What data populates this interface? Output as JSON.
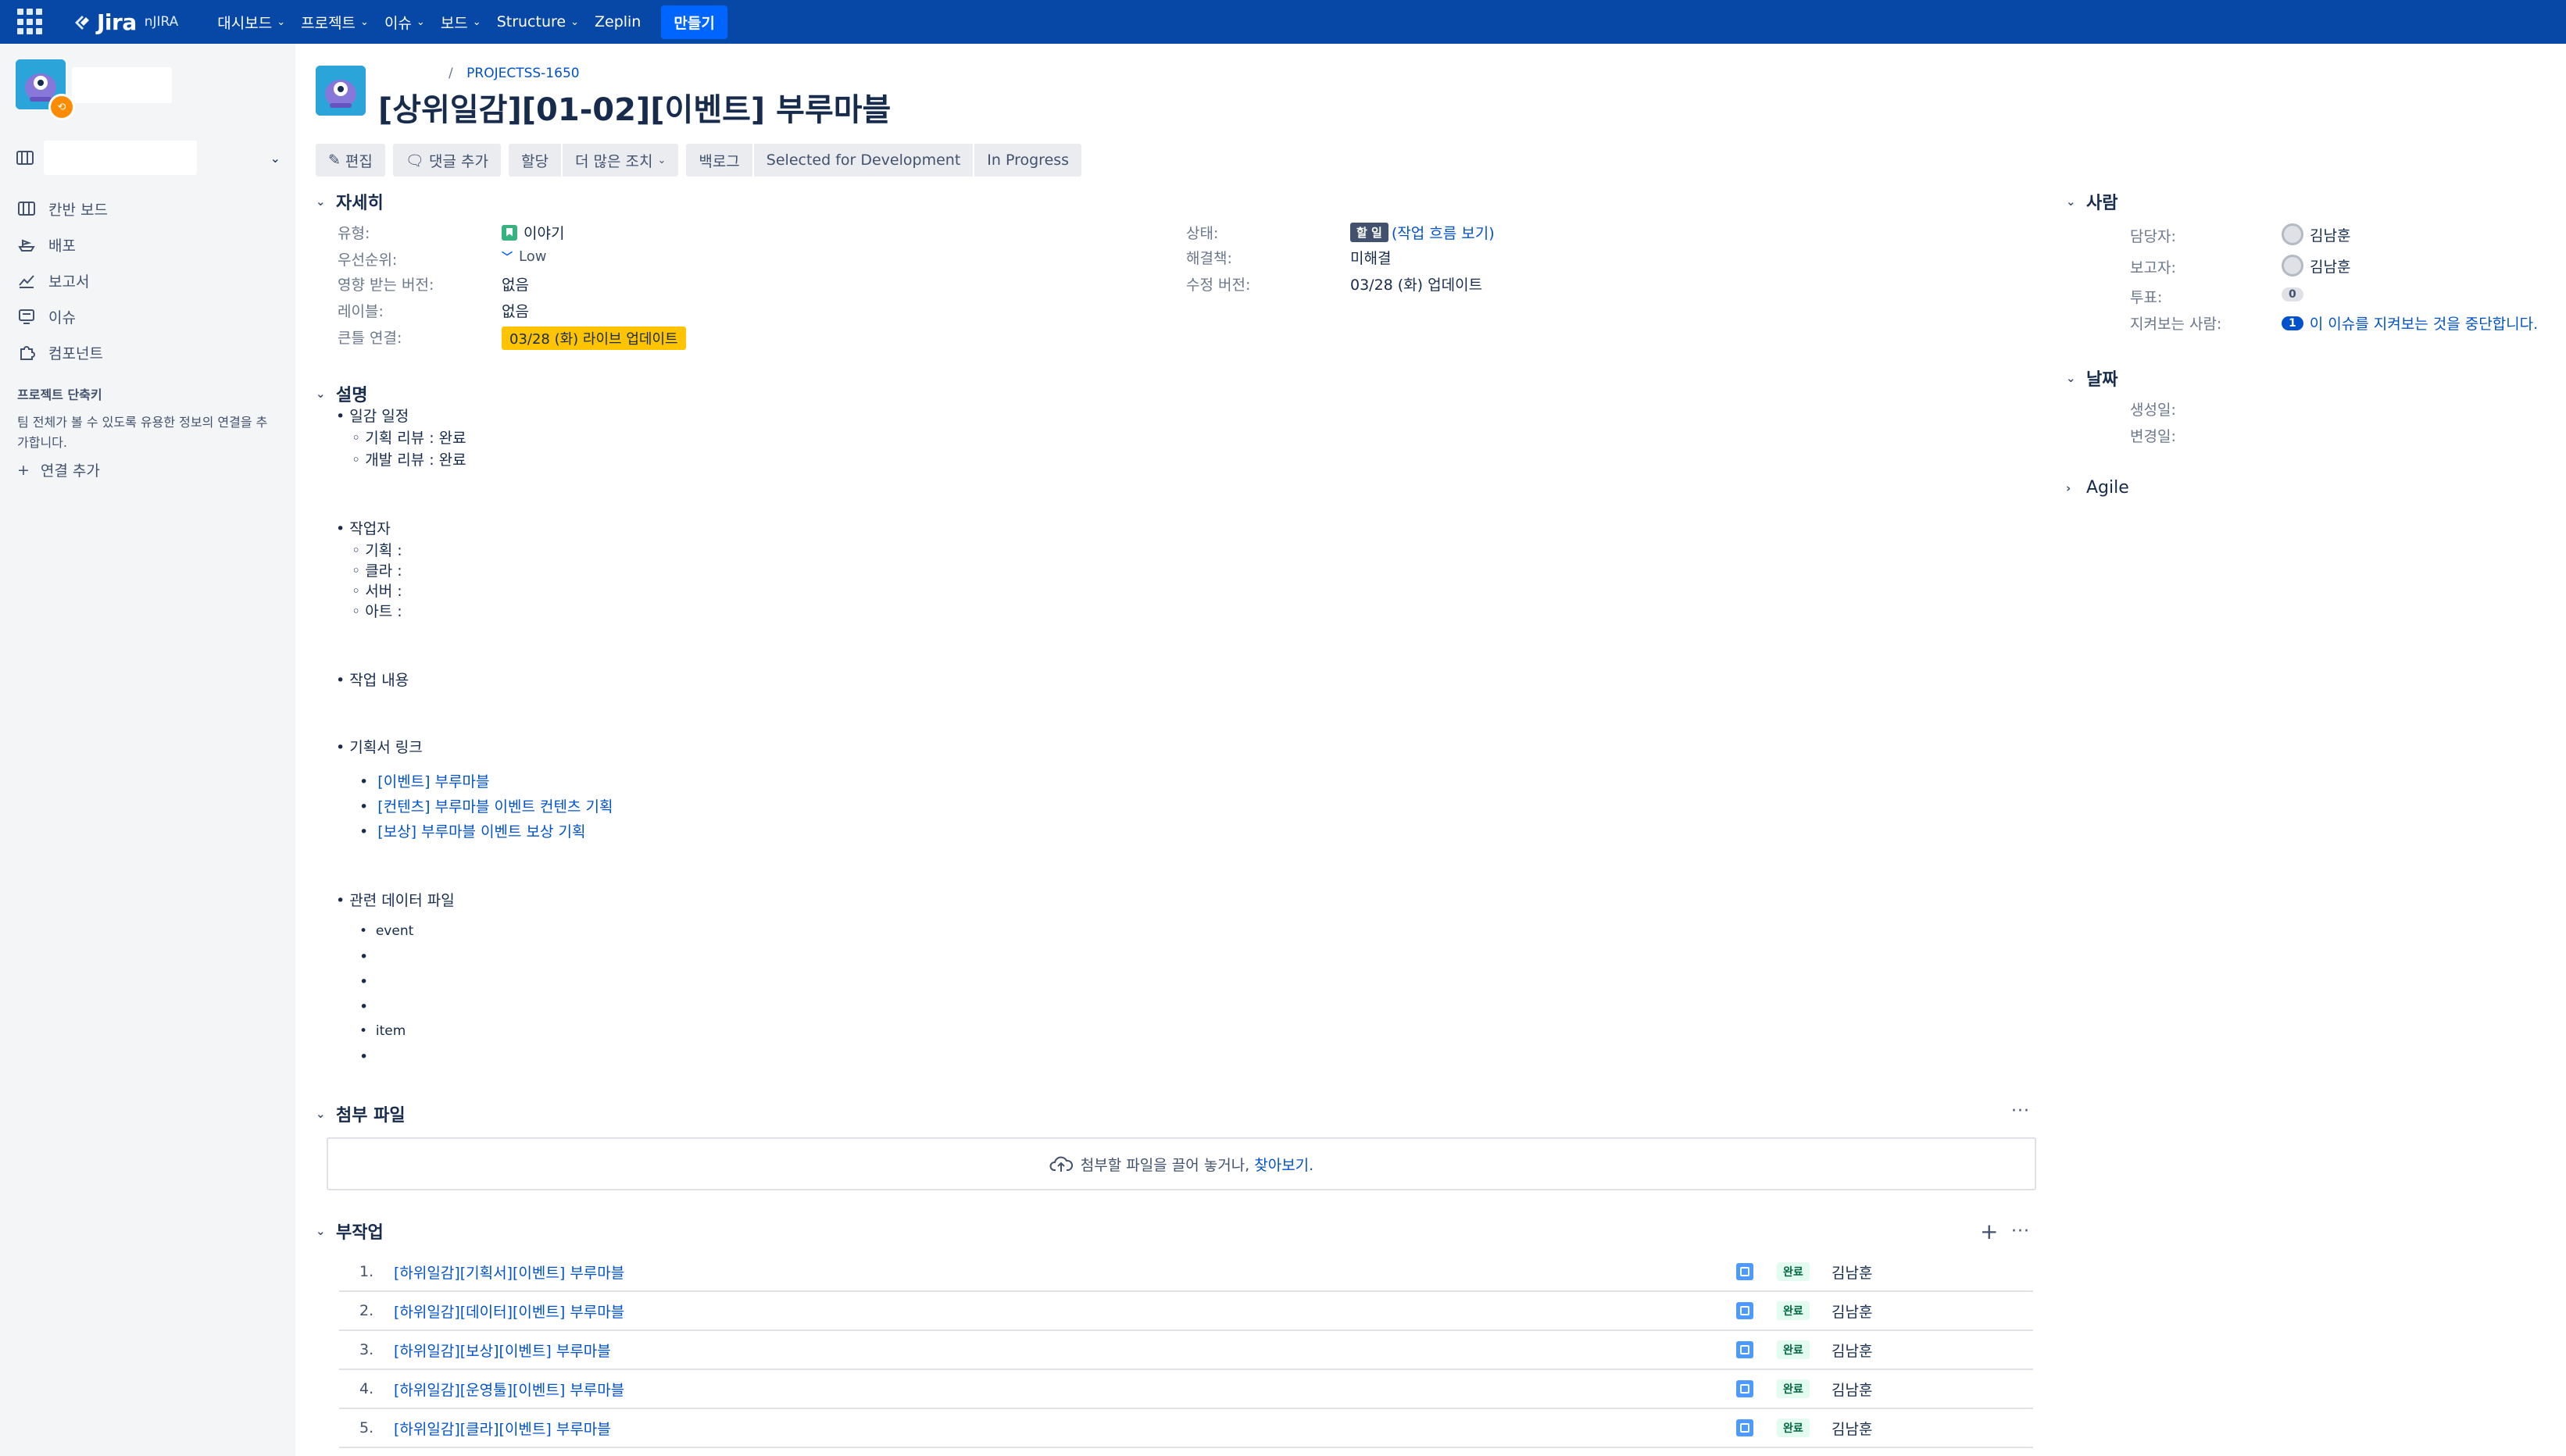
{
  "topnav": {
    "logo_text": "Jira",
    "logo_sub": "nJIRA",
    "menu": [
      {
        "label": "대시보드",
        "has_dropdown": true
      },
      {
        "label": "프로젝트",
        "has_dropdown": true
      },
      {
        "label": "이슈",
        "has_dropdown": true
      },
      {
        "label": "보드",
        "has_dropdown": true
      },
      {
        "label": "Structure",
        "has_dropdown": true
      },
      {
        "label": "Zeplin",
        "has_dropdown": false
      }
    ],
    "create_label": "만들기"
  },
  "sidebar": {
    "nav": [
      {
        "label": "칸반 보드",
        "icon": "board-icon"
      },
      {
        "label": "배포",
        "icon": "ship-icon"
      },
      {
        "label": "보고서",
        "icon": "chart-icon"
      },
      {
        "label": "이슈",
        "icon": "issues-icon"
      },
      {
        "label": "컴포넌트",
        "icon": "puzzle-icon"
      }
    ],
    "shortcuts_heading": "프로젝트 단축키",
    "shortcuts_desc": "팀 전체가 볼 수 있도록 유용한 정보의 연결을 추가합니다.",
    "add_link_label": "연결 추가"
  },
  "issue": {
    "breadcrumb_sep": "/",
    "key": "PROJECTSS-1650",
    "title": "[상위일감][01-02][이벤트] 부루마블"
  },
  "toolbar": {
    "edit": "편집",
    "comment": "댓글 추가",
    "assign": "할당",
    "more": "더 많은 조치",
    "backlog": "백로그",
    "selected": "Selected for Development",
    "in_progress": "In Progress"
  },
  "details": {
    "heading": "자세히",
    "left": [
      {
        "label": "유형:",
        "value": "이야기"
      },
      {
        "label": "우선순위:",
        "value": "Low"
      },
      {
        "label": "영향 받는 버전:",
        "value": "없음"
      },
      {
        "label": "레이블:",
        "value": "없음"
      },
      {
        "label": "큰틀 연결:",
        "value": "03/28 (화) 라이브 업데이트"
      }
    ],
    "right": [
      {
        "label": "상태:",
        "value": "할 일",
        "extra": "(작업 흐름 보기)"
      },
      {
        "label": "해결책:",
        "value": "미해결"
      },
      {
        "label": "수정 버전:",
        "value": "03/28 (화) 업데이트"
      }
    ]
  },
  "description": {
    "heading": "설명",
    "sched_title": "• 일감 일정",
    "sched_items": [
      "◦ 기획 리뷰 : 완료",
      "◦ 개발 리뷰 : 완료"
    ],
    "workers_title": "• 작업자",
    "workers_items": [
      "◦ 기획 :",
      "◦ 클라 :",
      "◦ 서버 :",
      "◦ 아트 :"
    ],
    "content_title": "• 작업 내용",
    "links_title": "• 기획서 링크",
    "links": [
      "[이벤트] 부루마블",
      "[컨텐츠] 부루마블 이벤트 컨텐츠 기획",
      "[보상] 부루마블 이벤트 보상 기획"
    ],
    "files_title": "• 관련 데이터 파일",
    "files": [
      "event",
      "",
      "",
      "",
      "item",
      ""
    ]
  },
  "attachments": {
    "heading": "첨부 파일",
    "drop_text": "첨부할 파일을 끌어 놓거나,",
    "browse": "찾아보기."
  },
  "subtasks": {
    "heading": "부작업",
    "rows": [
      {
        "num": "1.",
        "title": "[하위일감][기획서][이벤트] 부루마블",
        "status": "완료",
        "assignee": "김남훈"
      },
      {
        "num": "2.",
        "title": "[하위일감][데이터][이벤트] 부루마블",
        "status": "완료",
        "assignee": "김남훈"
      },
      {
        "num": "3.",
        "title": "[하위일감][보상][이벤트] 부루마블",
        "status": "완료",
        "assignee": "김남훈"
      },
      {
        "num": "4.",
        "title": "[하위일감][운영툴][이벤트] 부루마블",
        "status": "완료",
        "assignee": "김남훈"
      },
      {
        "num": "5.",
        "title": "[하위일감][클라][이벤트] 부루마블",
        "status": "완료",
        "assignee": "김남훈"
      }
    ]
  },
  "people": {
    "heading": "사람",
    "assignee_label": "담당자:",
    "assignee": "김남훈",
    "reporter_label": "보고자:",
    "reporter": "김남훈",
    "votes_label": "투표:",
    "votes": "0",
    "watchers_label": "지켜보는 사람:",
    "watchers": "1",
    "stop_watching": "이 이슈를 지켜보는 것을 중단합니다."
  },
  "dates": {
    "heading": "날짜",
    "created_label": "생성일:",
    "updated_label": "변경일:"
  },
  "agile": {
    "heading": "Agile"
  },
  "colors": {
    "nav_bg": "#0747a6",
    "link": "#0052cc",
    "label_tag": "#ffc400",
    "done_lozenge": "#e3fcef"
  }
}
